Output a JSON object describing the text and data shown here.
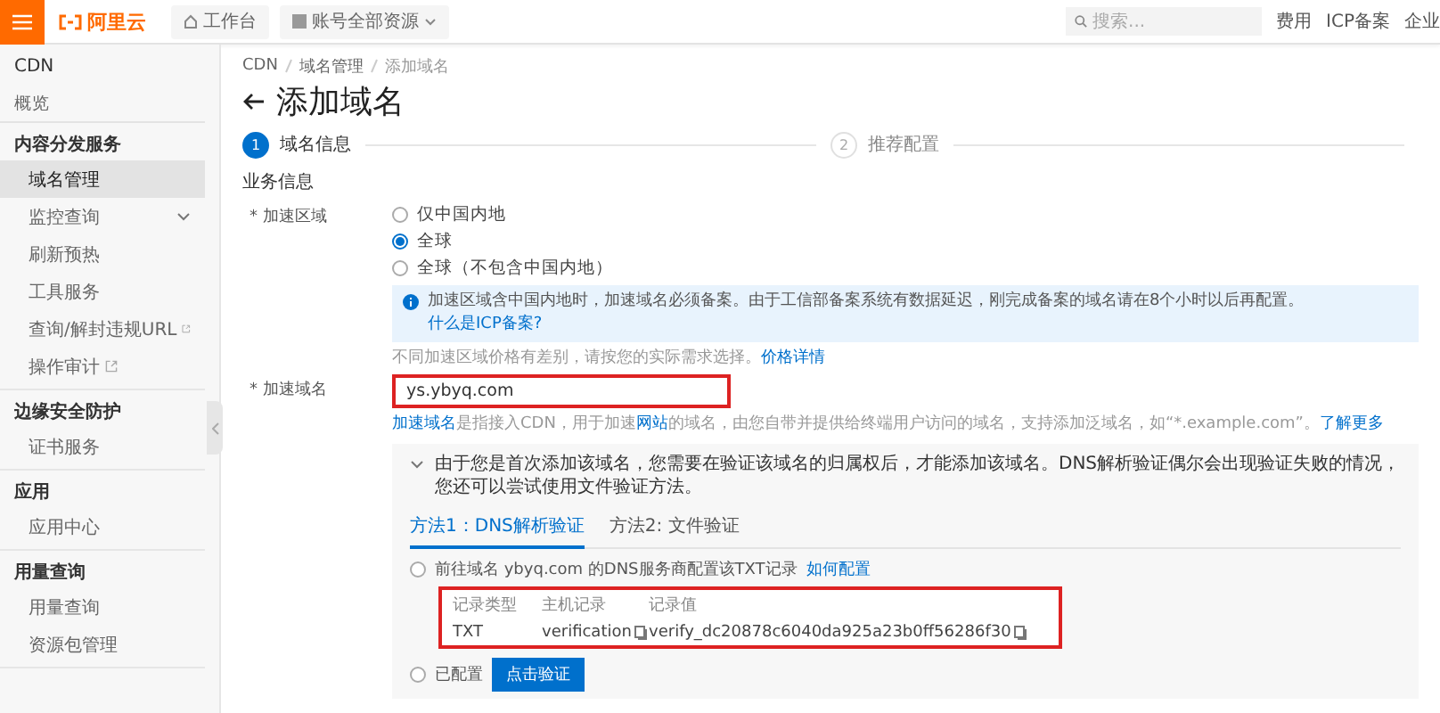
{
  "header": {
    "logo": "阿里云",
    "workbench": "工作台",
    "resource_scope": "账号全部资源",
    "search": {
      "placeholder": "搜索..."
    },
    "links": [
      "费用",
      "ICP备案",
      "企业"
    ]
  },
  "sidebar": {
    "title": "CDN",
    "overview": "概览",
    "groups": [
      {
        "heading": "内容分发服务",
        "items": [
          {
            "label": "域名管理",
            "selected": true,
            "expandable": false,
            "external": false
          },
          {
            "label": "监控查询",
            "selected": false,
            "expandable": true,
            "external": false
          },
          {
            "label": "刷新预热",
            "selected": false,
            "expandable": false,
            "external": false
          },
          {
            "label": "工具服务",
            "selected": false,
            "expandable": false,
            "external": false
          },
          {
            "label": "查询/解封违规URL",
            "selected": false,
            "expandable": false,
            "external": true
          },
          {
            "label": "操作审计",
            "selected": false,
            "expandable": false,
            "external": true
          }
        ]
      },
      {
        "heading": "边缘安全防护",
        "items": [
          {
            "label": "证书服务",
            "selected": false,
            "expandable": false,
            "external": false
          }
        ]
      },
      {
        "heading": "应用",
        "items": [
          {
            "label": "应用中心",
            "selected": false,
            "expandable": false,
            "external": false
          }
        ]
      },
      {
        "heading": "用量查询",
        "items": [
          {
            "label": "用量查询",
            "selected": false,
            "expandable": false,
            "external": false
          },
          {
            "label": "资源包管理",
            "selected": false,
            "expandable": false,
            "external": false
          }
        ]
      }
    ]
  },
  "breadcrumb": [
    "CDN",
    "域名管理",
    "添加域名"
  ],
  "page_title": "添加域名",
  "steps": [
    {
      "number": "1",
      "label": "域名信息",
      "selected": true
    },
    {
      "number": "2",
      "label": "推荐配置",
      "selected": false
    }
  ],
  "section_title": "业务信息",
  "region": {
    "label": "* 加速区域",
    "options": [
      {
        "label": "仅中国内地",
        "selected": false
      },
      {
        "label": "全球",
        "selected": true
      },
      {
        "label": "全球（不包含中国内地）",
        "selected": false
      }
    ],
    "notice": {
      "text": "加速区域含中国内地时，加速域名必须备案。由于工信部备案系统有数据延迟，刚完成备案的域名请在8个小时以后再配置。",
      "link": "什么是ICP备案?"
    },
    "hint": {
      "text": "不同加速区域价格有差别，请按您的实际需求选择。",
      "link": "价格详情"
    }
  },
  "domain": {
    "label": "* 加速域名",
    "value": "ys.ybyq.com",
    "highlighted": true,
    "hint": [
      {
        "text": "加速域名",
        "link": true
      },
      {
        "text": "是指接入CDN，用于加速",
        "link": false
      },
      {
        "text": "网站",
        "link": true
      },
      {
        "text": "的域名，由您自带并提供给终端用户访问的域名，支持添加泛域名，如“*.example.com”。",
        "link": false
      },
      {
        "text": "了解更多",
        "link": true
      }
    ]
  },
  "verification": {
    "expanded": true,
    "message": "由于您是首次添加该域名，您需要在验证该域名的归属权后，才能添加该域名。DNS解析验证偶尔会出现验证失败的情况，您还可以尝试使用文件验证方法。",
    "tabs": [
      {
        "label": "方法1：DNS解析验证",
        "selected": true
      },
      {
        "label": "方法2: 文件验证",
        "selected": false
      }
    ],
    "options": [
      {
        "kind": "record",
        "label": "前往域名 ybyq.com 的DNS服务商配置该TXT记录",
        "link": "如何配置",
        "selected": false
      },
      {
        "kind": "action",
        "label": "已配置",
        "button": "点击验证",
        "selected": false
      }
    ],
    "table": {
      "columns": [
        "记录类型",
        "主机记录",
        "记录值"
      ],
      "rows": [
        {
          "highlighted": true,
          "cells": [
            {
              "text": "TXT",
              "copyable": false
            },
            {
              "text": "verification",
              "copyable": true
            },
            {
              "text": "verify_dc20878c6040da925a23b0ff56286f30",
              "copyable": true
            }
          ]
        }
      ]
    }
  }
}
